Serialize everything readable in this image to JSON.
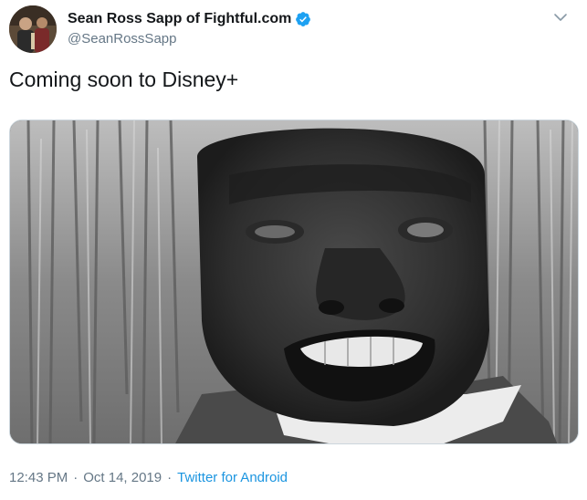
{
  "tweet": {
    "display_name": "Sean Ross Sapp of Fightful.com",
    "handle": "@SeanRossSapp",
    "verified": true,
    "text": "Coming soon to Disney+",
    "time": "12:43 PM",
    "date": "Oct 14, 2019",
    "separator": "·",
    "source": "Twitter for Android",
    "media_type": "video-still"
  },
  "icons": {
    "verified": "verified-badge-icon",
    "menu": "chevron-down-icon"
  },
  "colors": {
    "name": "#14171a",
    "secondary": "#657786",
    "link": "#1b95e0",
    "verified": "#1da1f2"
  }
}
